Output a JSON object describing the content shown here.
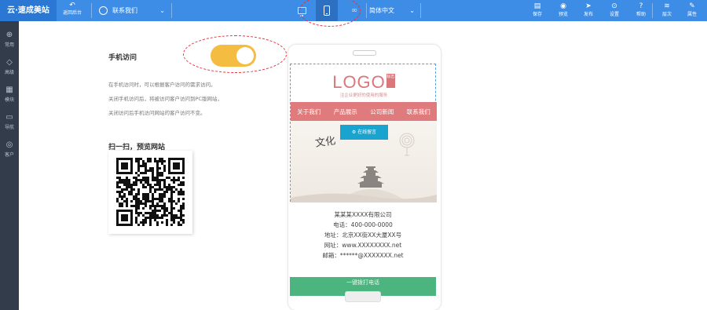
{
  "topbar": {
    "brand": "云·速成美站",
    "back_label": "返回后台",
    "page_select": "联系我们",
    "language": "简体中文",
    "right_tools": [
      {
        "label": "保存",
        "icon": "save-icon",
        "glyph": "▤"
      },
      {
        "label": "预览",
        "icon": "eye-icon",
        "glyph": "◉"
      },
      {
        "label": "发布",
        "icon": "send-icon",
        "glyph": "➤"
      },
      {
        "label": "设置",
        "icon": "settings-icon",
        "glyph": "⊙"
      },
      {
        "label": "帮助",
        "icon": "help-icon",
        "glyph": "?"
      },
      {
        "label": "层次",
        "icon": "layers-icon",
        "glyph": "≋"
      },
      {
        "label": "属性",
        "icon": "wrench-icon",
        "glyph": "✎"
      }
    ]
  },
  "sidebar": {
    "items": [
      {
        "label": "常用",
        "icon": "star-icon",
        "glyph": "⊕"
      },
      {
        "label": "高级",
        "icon": "diamond-icon",
        "glyph": "◇"
      },
      {
        "label": "模块",
        "icon": "grid-icon",
        "glyph": "▦"
      },
      {
        "label": "导航",
        "icon": "page-icon",
        "glyph": "▭"
      },
      {
        "label": "客户",
        "icon": "wifi-icon",
        "glyph": "◎"
      }
    ]
  },
  "mobile": {
    "label": "手机访问",
    "toggle_on": true,
    "desc": [
      "在手机访问时，可以根据客户访问的需求访问。",
      "关闭手机访问后，将被访问客户访问到PC版网站，",
      "关闭访问后手机访问网站的客户访问不变。"
    ],
    "scan_title": "扫一扫，预览网站"
  },
  "preview": {
    "logo_text": "LOGO",
    "logo_tag": "标志",
    "tagline": "注企业更好的使用的服务",
    "nav": [
      "关于我们",
      "产品展示",
      "公司新闻",
      "联系我们"
    ],
    "online_button": "⚙ 在线留言",
    "banner_text": "文化",
    "company": "某某某XXXX有限公司",
    "phone": "电话：400-000-0000",
    "address": "地址：北京XX街XX大厦XX号",
    "website": "网址：www.XXXXXXXX.net",
    "email": "邮箱：******@XXXXXXX.net",
    "green_bar": "一键拨打电话"
  },
  "colors": {
    "topbar": "#3d8de6",
    "sidebar": "#323c4a",
    "toggle": "#f4bd42",
    "nav": "#df7b7c",
    "green": "#4cb57f",
    "annotation": "#e8303a"
  }
}
